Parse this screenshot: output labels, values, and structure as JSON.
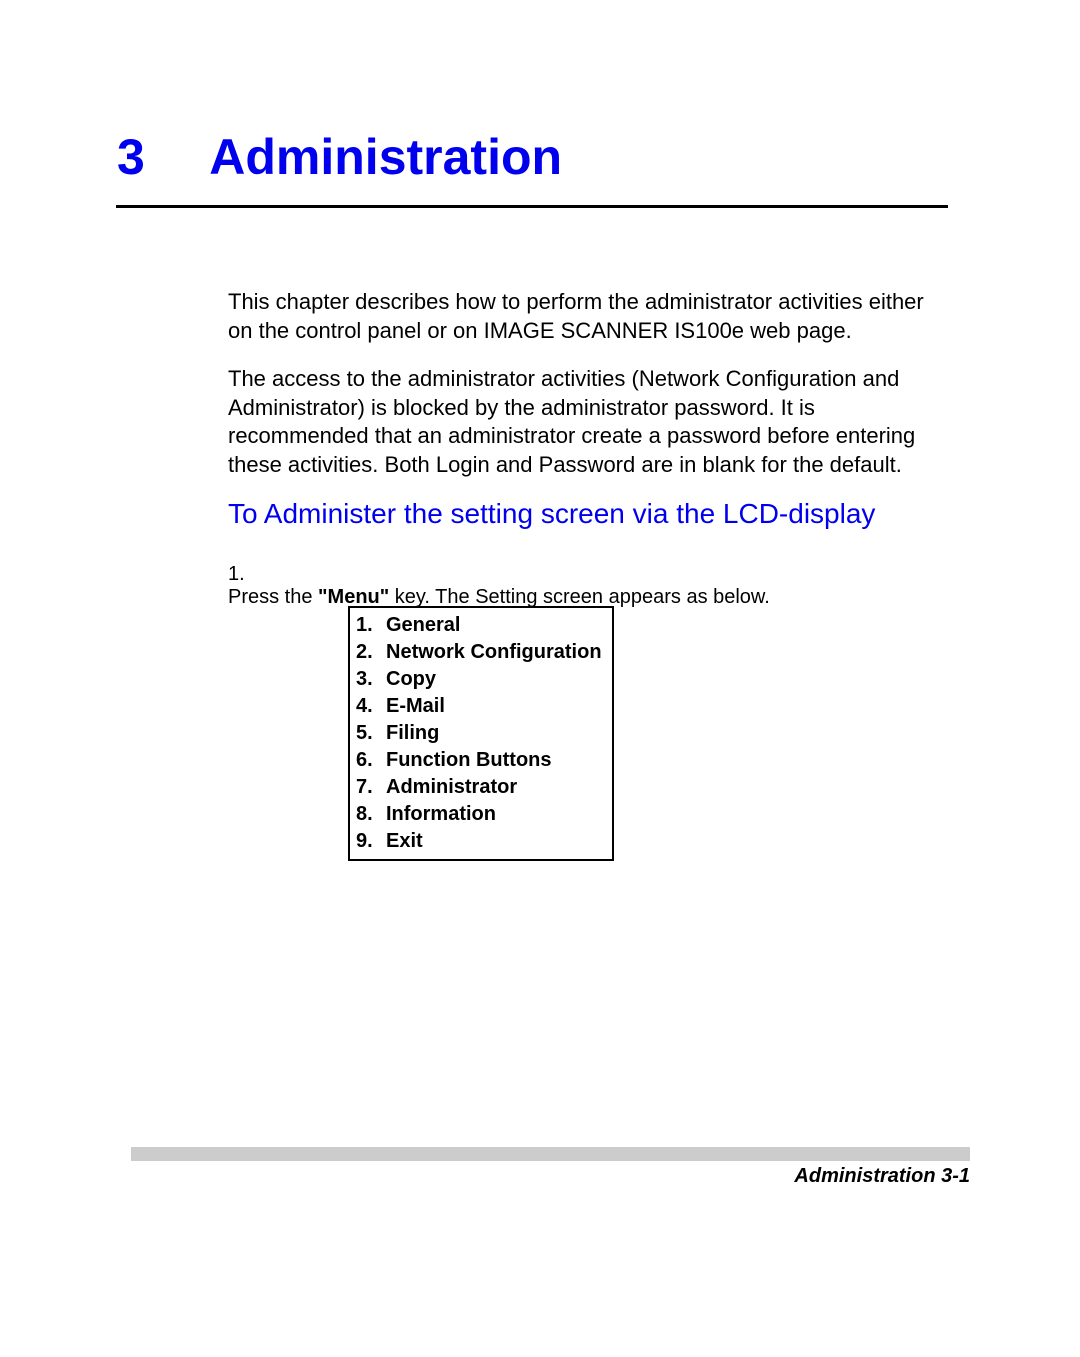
{
  "chapter": {
    "number": "3",
    "title": "Administration"
  },
  "paragraphs": {
    "p1": "This chapter describes how to perform the administrator activities either on the control panel or on IMAGE SCANNER IS100e web page.",
    "p2": "The access to the administrator activities (Network Configuration and Administrator) is blocked by the administrator password. It is recommended that an administrator create a password before entering these activities. Both Login and Password are in blank for the default."
  },
  "section_title": "To Administer the setting screen via the LCD-display",
  "step": {
    "number": "1.",
    "before": "Press the ",
    "bold": "\"Menu\"",
    "after": " key. The Setting screen appears as below."
  },
  "lcd_menu": [
    {
      "num": "1.",
      "label": "General"
    },
    {
      "num": "2.",
      "label": "Network Configuration"
    },
    {
      "num": "3.",
      "label": "Copy"
    },
    {
      "num": "4.",
      "label": "E-Mail"
    },
    {
      "num": "5.",
      "label": "Filing"
    },
    {
      "num": "6.",
      "label": "Function Buttons"
    },
    {
      "num": "7.",
      "label": "Administrator"
    },
    {
      "num": "8.",
      "label": "Information"
    },
    {
      "num": "9.",
      "label": "Exit"
    }
  ],
  "footer": "Administration  3-1"
}
